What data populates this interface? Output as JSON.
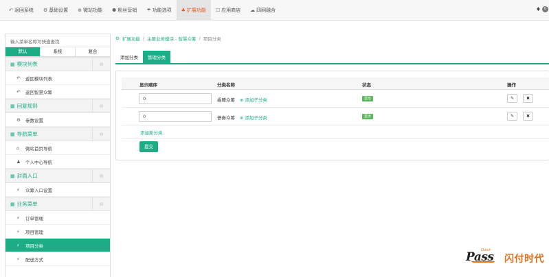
{
  "topnav": [
    {
      "icon": "↶",
      "icon_name": "reply-icon",
      "label": "返回系统",
      "active": false
    },
    {
      "icon": "⚙",
      "icon_name": "gear-icon",
      "label": "基础设置",
      "active": false
    },
    {
      "icon": "⊕",
      "icon_name": "globe-icon",
      "label": "微站功能",
      "active": false
    },
    {
      "icon": "⚉",
      "icon_name": "users-icon",
      "label": "粉丝营销",
      "active": false
    },
    {
      "icon": "☂",
      "icon_name": "umbrella-icon",
      "label": "功能选项",
      "active": false
    },
    {
      "icon": "♣",
      "icon_name": "cubes-icon",
      "label": "扩展功能",
      "active": true
    },
    {
      "icon": "☐",
      "icon_name": "desktop-icon",
      "label": "应用商店",
      "active": false
    },
    {
      "icon": "☁",
      "icon_name": "cloud-icon",
      "label": "四网融合",
      "active": false
    }
  ],
  "notifications": {
    "count": "0"
  },
  "sidebar": {
    "search_placeholder": "输入菜单名称可快速查找",
    "tabs": [
      "默认",
      "系统",
      "复合"
    ],
    "active_tab": 0,
    "sections": [
      {
        "title": "模块列表",
        "items": [
          {
            "icon": "↶",
            "icon_name": "reply-icon",
            "label": "返回模块列表",
            "active": false
          },
          {
            "icon": "↶",
            "icon_name": "reply-icon",
            "label": "返回智慧众筹",
            "active": false
          }
        ]
      },
      {
        "title": "回复规则",
        "items": [
          {
            "icon": "⚙",
            "icon_name": "gear-icon",
            "label": "参数设置",
            "active": false
          }
        ]
      },
      {
        "title": "导航菜单",
        "items": [
          {
            "icon": "⌂",
            "icon_name": "home-icon",
            "label": "微站首页导航",
            "active": false
          },
          {
            "icon": "♟",
            "icon_name": "user-icon",
            "label": "个人中心导航",
            "active": false
          }
        ]
      },
      {
        "title": "封面入口",
        "items": [
          {
            "icon": "⚡",
            "icon_name": "puzzle-icon",
            "label": "众筹入口设置",
            "active": false
          }
        ]
      },
      {
        "title": "业务菜单",
        "items": [
          {
            "icon": "⚡",
            "icon_name": "puzzle-icon",
            "label": "订单管理",
            "active": false
          },
          {
            "icon": "⚡",
            "icon_name": "puzzle-icon",
            "label": "项目管理",
            "active": false
          },
          {
            "icon": "⚡",
            "icon_name": "puzzle-icon",
            "label": "项目分类",
            "active": true
          },
          {
            "icon": "⚡",
            "icon_name": "puzzle-icon",
            "label": "配送方式",
            "active": false
          }
        ]
      }
    ]
  },
  "breadcrumb": {
    "items": [
      "扩展功能",
      "主要业务模块 - 智慧众筹",
      "项目分类"
    ]
  },
  "content_tabs": [
    {
      "label": "添加分类",
      "active": false
    },
    {
      "label": "管理分类",
      "active": true
    }
  ],
  "table": {
    "headers": {
      "order": "显示顺序",
      "name": "分类名称",
      "status": "状态",
      "actions": "操作"
    },
    "rows": [
      {
        "order": "0",
        "name": "捐赠众筹",
        "add_child": "添加子分类",
        "status": "显示"
      },
      {
        "order": "0",
        "name": "债券众筹",
        "add_child": "添加子分类",
        "status": "显示"
      }
    ],
    "add_new": "添加新分类",
    "submit": "提交"
  },
  "logo": {
    "quick": "Quick",
    "pass": "Pass",
    "text": "闪付时代"
  },
  "colors": {
    "accent": "#1cad86",
    "active_nav": "#e85b1f",
    "status": "#5cb85c",
    "logo": "#e3711b"
  }
}
